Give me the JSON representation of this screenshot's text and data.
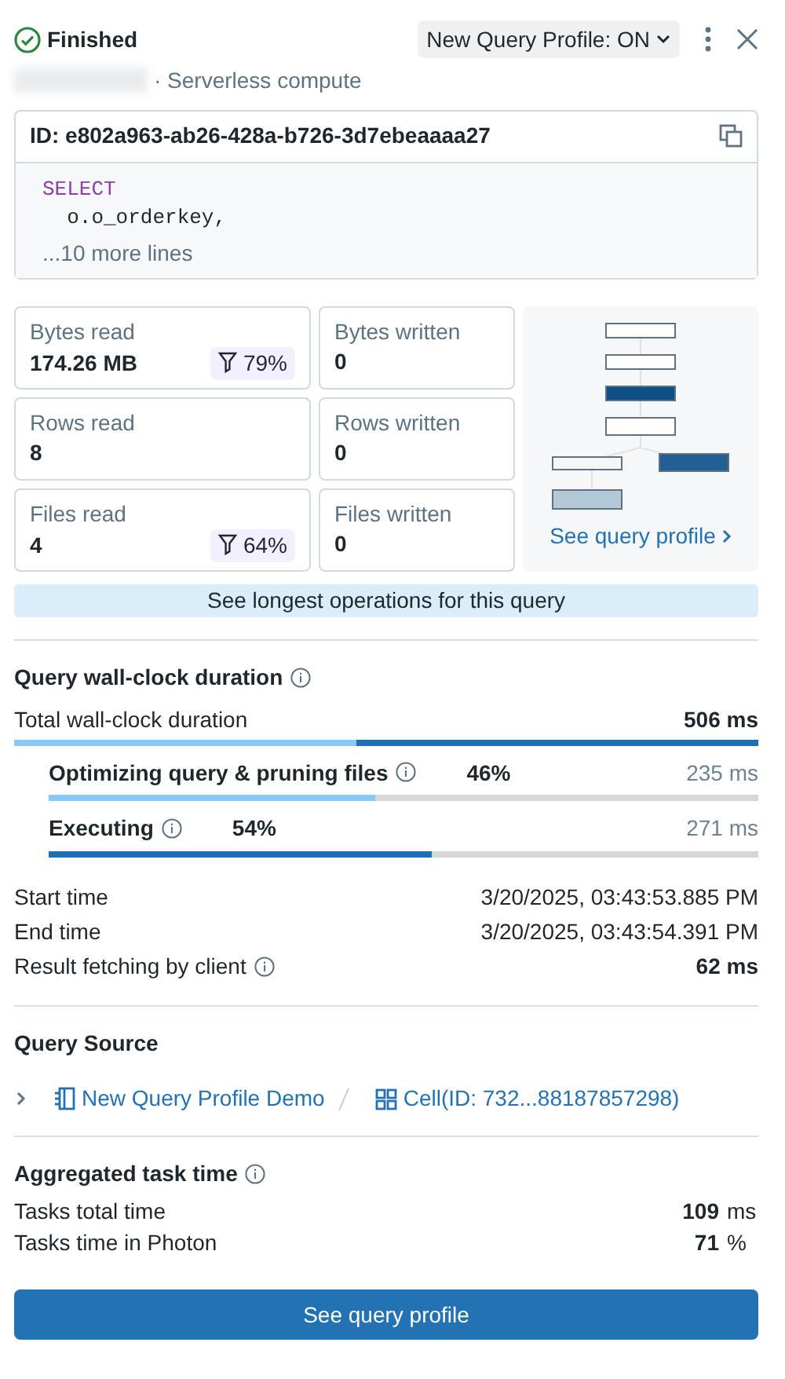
{
  "header": {
    "status": "Finished",
    "profile_toggle": "New Query Profile: ON",
    "subtitle": "· Serverless compute"
  },
  "query": {
    "id": "ID: e802a963-ab26-428a-b726-3d7ebeaaaa27",
    "keyword": "SELECT",
    "line": "  o.o_orderkey,",
    "more": "...10 more lines"
  },
  "stats": [
    {
      "label": "Bytes read",
      "value": "174.26 MB",
      "filter": "79%"
    },
    {
      "label": "Bytes written",
      "value": "0"
    },
    {
      "label": "Rows read",
      "value": "8"
    },
    {
      "label": "Rows written",
      "value": "0"
    },
    {
      "label": "Files read",
      "value": "4",
      "filter": "64%"
    },
    {
      "label": "Files written",
      "value": "0"
    }
  ],
  "profile_link": "See query profile",
  "longest_button": "See longest operations for this query",
  "duration": {
    "title": "Query wall-clock duration",
    "total_label": "Total wall-clock duration",
    "total_value": "506 ms",
    "phases": [
      {
        "label": "Optimizing query & pruning files",
        "percent": "46%",
        "time": "235 ms",
        "level": 0.46,
        "color": "#8ac8f7"
      },
      {
        "label": "Executing",
        "percent": "54%",
        "time": "271 ms",
        "level": 0.54,
        "color": "#1f6fb5"
      }
    ],
    "times": [
      {
        "label": "Start time",
        "value": "3/20/2025, 03:43:53.885 PM",
        "info": false,
        "bold": false
      },
      {
        "label": "End time",
        "value": "3/20/2025, 03:43:54.391 PM",
        "info": false,
        "bold": false
      },
      {
        "label": "Result fetching by client",
        "value": "62 ms",
        "info": true,
        "bold": true
      }
    ]
  },
  "source": {
    "title": "Query Source",
    "expanded": false,
    "notebook": "New Query Profile Demo",
    "cell": "Cell(ID: 732...88187857298)"
  },
  "tasks": {
    "title": "Aggregated task time",
    "rows": [
      {
        "label": "Tasks total time",
        "value": "109",
        "unit": "ms"
      },
      {
        "label": "Tasks time in Photon",
        "value": "71",
        "unit": "%"
      }
    ]
  },
  "footer_button": "See query profile"
}
